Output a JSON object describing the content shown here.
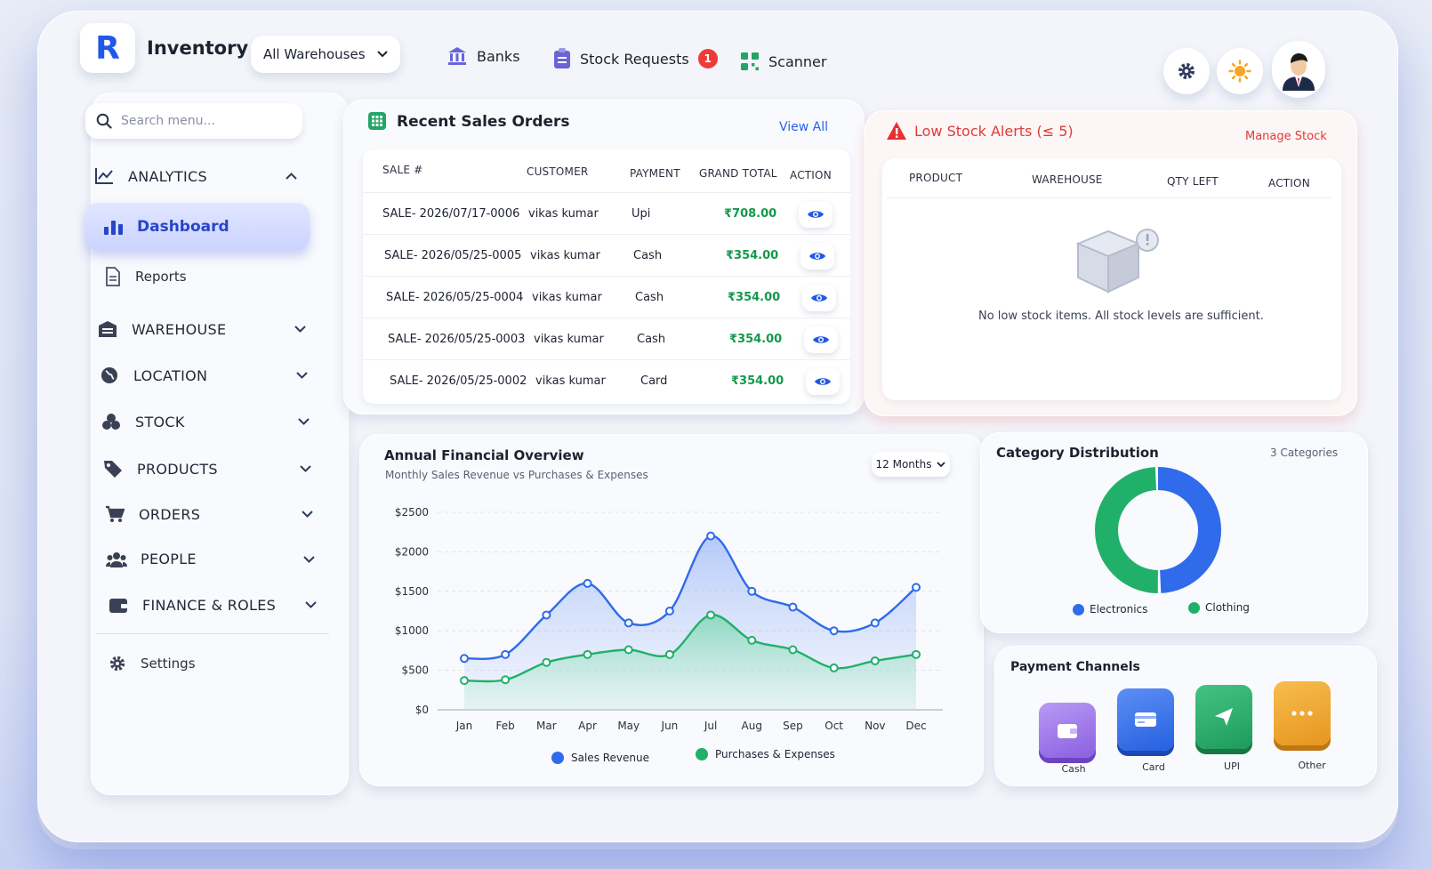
{
  "header": {
    "logo_letter": "R",
    "app_title": "Inventory",
    "warehouse_select": "All Warehouses",
    "nav": [
      {
        "label": "Banks",
        "icon": "bank-icon"
      },
      {
        "label": "Stock Requests",
        "icon": "clipboard-icon",
        "badge": "1"
      },
      {
        "label": "Scanner",
        "icon": "qr-icon"
      }
    ]
  },
  "sidebar": {
    "search_placeholder": "Search menu...",
    "analytics": "ANALYTICS",
    "dashboard": "Dashboard",
    "reports": "Reports",
    "sections": [
      "WAREHOUSE",
      "LOCATION",
      "STOCK",
      "PRODUCTS",
      "ORDERS",
      "PEOPLE",
      "FINANCE & ROLES"
    ],
    "settings": "Settings"
  },
  "sales": {
    "title": "Recent Sales Orders",
    "view_all": "View All",
    "columns": [
      "SALE #",
      "CUSTOMER",
      "PAYMENT",
      "GRAND TOTAL",
      "ACTION"
    ],
    "rows": [
      {
        "sale": "SALE- 2026/07/17-0006",
        "customer": "vikas kumar",
        "payment": "Upi",
        "total": "₹708.00"
      },
      {
        "sale": "SALE- 2026/05/25-0005",
        "customer": "vikas kumar",
        "payment": "Cash",
        "total": "₹354.00"
      },
      {
        "sale": "SALE- 2026/05/25-0004",
        "customer": "vikas kumar",
        "payment": "Cash",
        "total": "₹354.00"
      },
      {
        "sale": "SALE- 2026/05/25-0003",
        "customer": "vikas kumar",
        "payment": "Cash",
        "total": "₹354.00"
      },
      {
        "sale": "SALE- 2026/05/25-0002",
        "customer": "vikas kumar",
        "payment": "Card",
        "total": "₹354.00"
      }
    ]
  },
  "low_stock": {
    "title": "Low Stock Alerts (≤ 5)",
    "manage": "Manage Stock",
    "columns": [
      "PRODUCT",
      "WAREHOUSE",
      "QTY LEFT",
      "ACTION"
    ],
    "empty_message": "No low stock items. All stock levels are sufficient."
  },
  "finance": {
    "title": "Annual Financial Overview",
    "subtitle": "Monthly Sales Revenue vs Purchases & Expenses",
    "range_button": "12 Months"
  },
  "chart_data": {
    "type": "area",
    "title": "Annual Financial Overview",
    "categories": [
      "Jan",
      "Feb",
      "Mar",
      "Apr",
      "May",
      "Jun",
      "Jul",
      "Aug",
      "Sep",
      "Oct",
      "Nov",
      "Dec"
    ],
    "ylim": [
      0,
      2500
    ],
    "yticks": [
      "$0",
      "$500",
      "$1000",
      "$1500",
      "$2000",
      "$2500"
    ],
    "ytick_values": [
      0,
      500,
      1000,
      1500,
      2000,
      2500
    ],
    "grid": true,
    "legend": "bottom",
    "series": [
      {
        "name": "Sales Revenue",
        "color": "#2f6bea",
        "values": [
          650,
          700,
          1200,
          1600,
          1100,
          1250,
          2200,
          1500,
          1300,
          1000,
          1100,
          1550
        ]
      },
      {
        "name": "Purchases & Expenses",
        "color": "#21b06a",
        "values": [
          370,
          380,
          600,
          700,
          760,
          700,
          1200,
          880,
          760,
          530,
          620,
          700
        ]
      }
    ]
  },
  "category": {
    "title": "Category Distribution",
    "count_label": "3 Categories",
    "legend": [
      {
        "name": "Electronics",
        "color": "#2f6bea"
      },
      {
        "name": "Clothing",
        "color": "#21b06a"
      }
    ]
  },
  "category_chart": {
    "type": "pie",
    "values": [
      50,
      50
    ],
    "colors": [
      "#2f6bea",
      "#21b06a"
    ]
  },
  "payment": {
    "title": "Payment Channels",
    "channels": [
      {
        "label": "Cash",
        "color": "#9b72e8",
        "icon": "wallet-icon"
      },
      {
        "label": "Card",
        "color": "#2f6bea",
        "icon": "card-icon"
      },
      {
        "label": "UPI",
        "color": "#22a565",
        "icon": "send-icon"
      },
      {
        "label": "Other",
        "color": "#f0a52c",
        "icon": "more-icon"
      }
    ]
  }
}
